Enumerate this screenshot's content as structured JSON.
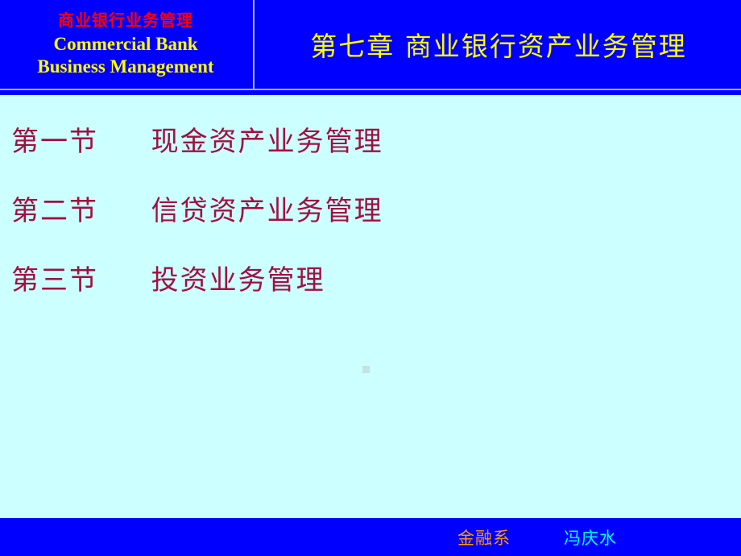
{
  "slide": {
    "background_color": "#ccffff",
    "header": {
      "background_color": "#0000ff",
      "brand_chinese": "商业银行业务管理",
      "brand_chinese_color": "#ff0000",
      "brand_english_line1": "Commercial Bank",
      "brand_english_line2": "Business Management",
      "brand_english_color": "#ffff00",
      "chapter_title": "第七章 商业银行资产业务管理",
      "chapter_title_color": "#ffff00",
      "divider_color": "#a8bcf7"
    },
    "body": {
      "text_color": "#a01040",
      "sections": [
        {
          "number": "第一节",
          "title": "现金资产业务管理"
        },
        {
          "number": "第二节",
          "title": "信贷资产业务管理"
        },
        {
          "number": "第三节",
          "title": "投资业务管理"
        }
      ],
      "placeholder_marker_color": "#c2e3e3"
    },
    "footer": {
      "background_color": "#0000ff",
      "department": "金融系",
      "department_color": "#ff9900",
      "author": "冯庆水",
      "author_color": "#00ffff"
    }
  }
}
